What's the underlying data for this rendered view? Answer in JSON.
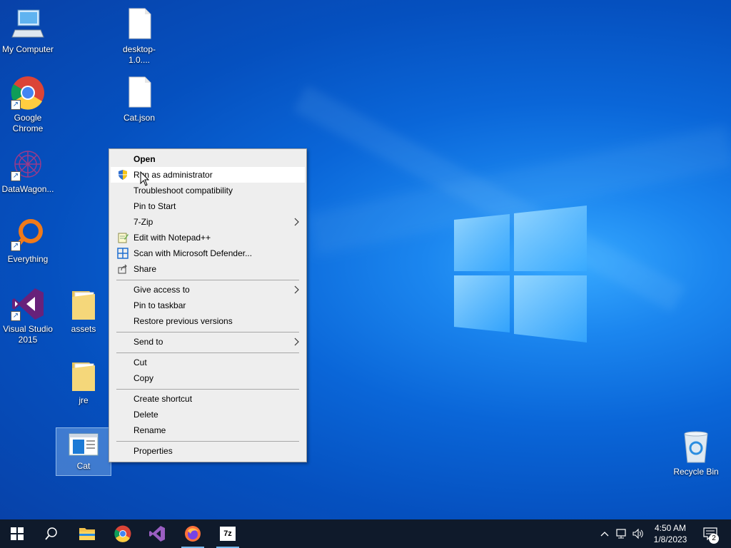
{
  "desktop": {
    "icons": [
      {
        "label": "My Computer",
        "icon": "computer-icon"
      },
      {
        "label": "desktop-1.0....",
        "icon": "file-icon"
      },
      {
        "label": "Google Chrome",
        "icon": "chrome-icon"
      },
      {
        "label": "Cat.json",
        "icon": "file-icon"
      },
      {
        "label": "DataWagon...",
        "icon": "datawagon-icon"
      },
      {
        "label": "Everything",
        "icon": "everything-icon"
      },
      {
        "label": "Visual Studio 2015",
        "icon": "visual-studio-icon"
      },
      {
        "label": "assets",
        "icon": "folder-icon"
      },
      {
        "label": "jre",
        "icon": "folder-icon"
      },
      {
        "label": "Cat",
        "icon": "app-icon"
      },
      {
        "label": "Recycle Bin",
        "icon": "recycle-bin-icon"
      }
    ]
  },
  "context_menu": {
    "items": [
      {
        "label": "Open"
      },
      {
        "label": "Run as administrator",
        "icon": "uac-shield-icon"
      },
      {
        "label": "Troubleshoot compatibility"
      },
      {
        "label": "Pin to Start"
      },
      {
        "label": "7-Zip"
      },
      {
        "label": "Edit with Notepad++",
        "icon": "notepad-plus-plus-icon"
      },
      {
        "label": "Scan with Microsoft Defender...",
        "icon": "defender-icon"
      },
      {
        "label": "Share",
        "icon": "share-icon"
      },
      {
        "label": "Give access to"
      },
      {
        "label": "Pin to taskbar"
      },
      {
        "label": "Restore previous versions"
      },
      {
        "label": "Send to"
      },
      {
        "label": "Cut"
      },
      {
        "label": "Copy"
      },
      {
        "label": "Create shortcut"
      },
      {
        "label": "Delete"
      },
      {
        "label": "Rename"
      },
      {
        "label": "Properties"
      }
    ]
  },
  "taskbar": {
    "apps": [
      "start-icon",
      "search-icon",
      "file-explorer-icon",
      "chrome-icon",
      "visual-studio-icon",
      "firefox-icon",
      "7zip-icon"
    ],
    "clock_time": "4:50 AM",
    "clock_date": "1/8/2023",
    "notification_count": "2",
    "sevenzip_label": "7z"
  },
  "colors": {
    "accent": "#0a66d8",
    "taskbar": "#0f1a2b",
    "menu_bg": "#eeeeee",
    "menu_hover": "#ffffff"
  }
}
